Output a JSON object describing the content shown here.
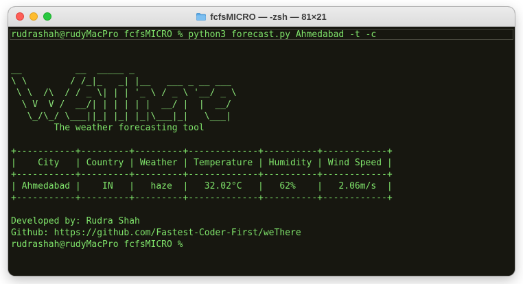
{
  "window": {
    "title": "fcfsMICRO — -zsh — 81×21"
  },
  "terminal": {
    "command_line": "rudrashah@rudyMacPro fcfsMICRO % python3 forecast.py Ahmedabad -t -c",
    "ascii_art": [
      "__          __  _____ _",
      "\\ \\        / /_|_   _| |__   ___ _ __ ___",
      " \\ \\  /\\  / / _ \\| | | '_ \\ / _ \\ '__/ _ \\",
      "  \\ V  V /  __/| | | | | |  __/ |  |  __/",
      "   \\_/\\_/ \\___||_| |_| |_|\\___|_|   \\___|"
    ],
    "tagline": "        The weather forecasting tool",
    "table_lines": [
      "+-----------+---------+---------+-------------+----------+------------+",
      "|    City   | Country | Weather | Temperature | Humidity | Wind Speed |",
      "+-----------+---------+---------+-------------+----------+------------+",
      "| Ahmedabad |    IN   |   haze  |   32.02°C   |   62%    |   2.06m/s  |",
      "+-----------+---------+---------+-------------+----------+------------+"
    ],
    "developed_by": "Developed by: Rudra Shah",
    "github": "Github: https://github.com/Fastest-Coder-First/weThere",
    "prompt": "rudrashah@rudyMacPro fcfsMICRO %"
  }
}
